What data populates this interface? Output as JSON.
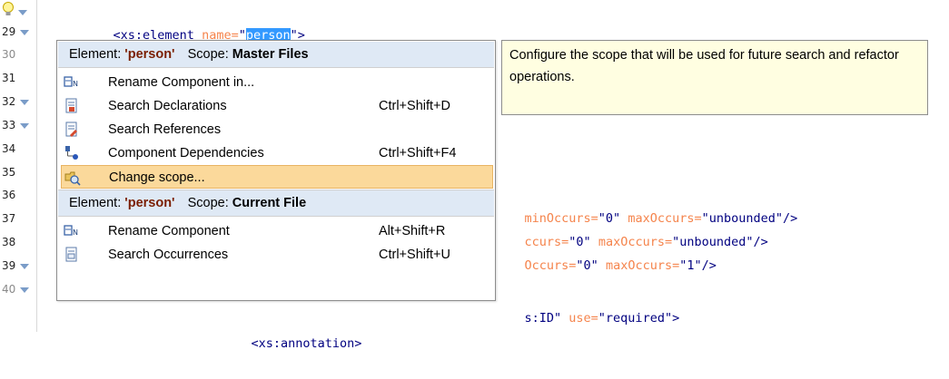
{
  "editor": {
    "gutter": [
      {
        "num": "",
        "fold": true,
        "bulb": true
      },
      {
        "num": "29",
        "fold": true
      },
      {
        "num": "30",
        "fold": false
      },
      {
        "num": "31",
        "fold": false
      },
      {
        "num": "32",
        "fold": true
      },
      {
        "num": "33",
        "fold": true
      },
      {
        "num": "34",
        "fold": false
      },
      {
        "num": "35",
        "fold": false
      },
      {
        "num": "36",
        "fold": false
      },
      {
        "num": "37",
        "fold": false
      },
      {
        "num": "38",
        "fold": false
      },
      {
        "num": "39",
        "fold": true
      },
      {
        "num": "40",
        "fold": true
      }
    ],
    "line0": {
      "open": "<xs:element ",
      "attr": "name=",
      "q1": "\"",
      "sel": "person",
      "q2": "\"",
      "close": ">"
    },
    "line35": {
      "attr1": "minOccurs=",
      "v1": "\"0\"",
      "attr2": " maxOccurs=",
      "v2": "\"unbounded\"",
      "close": "/>"
    },
    "line36": {
      "attr1": "ccurs=",
      "v1": "\"0\"",
      "attr2": " maxOccurs=",
      "v2": "\"unbounded\"",
      "close": "/>"
    },
    "line37": {
      "attr1": "Occurs=",
      "v1": "\"0\"",
      "attr2": " maxOccurs=",
      "v2": "\"1\"",
      "close": "/>"
    },
    "line39": {
      "v1": "s:ID\"",
      "attr2": " use=",
      "v2": "\"required\"",
      "close": ">"
    },
    "line40": {
      "text": "<xs:annotation>"
    }
  },
  "popup": {
    "header1": {
      "element_label": "Element:",
      "element_value": "'person'",
      "scope_label": "Scope:",
      "scope_value": "Master Files"
    },
    "items1": [
      {
        "icon": "rename-icon",
        "label": "Rename Component in...",
        "shortcut": ""
      },
      {
        "icon": "search-declarations-icon",
        "label": "Search Declarations",
        "shortcut": "Ctrl+Shift+D"
      },
      {
        "icon": "search-references-icon",
        "label": "Search References",
        "shortcut": ""
      },
      {
        "icon": "component-dependencies-icon",
        "label": "Component Dependencies",
        "shortcut": "Ctrl+Shift+F4"
      },
      {
        "icon": "change-scope-icon",
        "label": "Change scope...",
        "shortcut": ""
      }
    ],
    "header2": {
      "element_label": "Element:",
      "element_value": "'person'",
      "scope_label": "Scope:",
      "scope_value": "Current File"
    },
    "items2": [
      {
        "icon": "rename-icon",
        "label": "Rename Component",
        "shortcut": "Alt+Shift+R"
      },
      {
        "icon": "search-occurrences-icon",
        "label": "Search Occurrences",
        "shortcut": "Ctrl+Shift+U"
      }
    ]
  },
  "tooltip": {
    "text": "Configure the scope that will be used for future search and refactor operations."
  }
}
